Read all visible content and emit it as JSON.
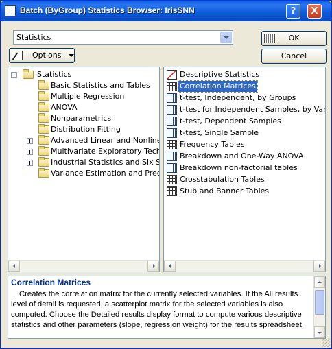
{
  "window": {
    "title": "Batch (ByGroup) Statistics Browser: IrisSNN",
    "help_label": "?",
    "close_label": "X"
  },
  "combo": {
    "value": "Statistics"
  },
  "buttons": {
    "ok": "OK",
    "cancel": "Cancel",
    "options": "Options"
  },
  "tree": {
    "root": "Statistics",
    "items": [
      {
        "label": "Basic Statistics and Tables",
        "expandable": false
      },
      {
        "label": "Multiple Regression",
        "expandable": false
      },
      {
        "label": "ANOVA",
        "expandable": false
      },
      {
        "label": "Nonparametrics",
        "expandable": false
      },
      {
        "label": "Distribution Fitting",
        "expandable": false
      },
      {
        "label": "Advanced Linear and Nonlinear M",
        "expandable": true
      },
      {
        "label": "Multivariate Exploratory Techniqu",
        "expandable": true
      },
      {
        "label": "Industrial Statistics and Six Sigma",
        "expandable": true
      },
      {
        "label": "Variance Estimation and Precision",
        "expandable": false
      }
    ]
  },
  "list": {
    "items": [
      {
        "label": "Descriptive Statistics",
        "icon": "chart-icon",
        "selected": false
      },
      {
        "label": "Correlation Matrices",
        "icon": "matrix-icon",
        "selected": true
      },
      {
        "label": "t-test, Independent, by Groups",
        "icon": "ttest-icon",
        "selected": false
      },
      {
        "label": "t-test for Independent Samples, by Variables",
        "icon": "ttest-icon",
        "selected": false
      },
      {
        "label": "t-test, Dependent Samples",
        "icon": "ttest-icon",
        "selected": false
      },
      {
        "label": "t-test, Single Sample",
        "icon": "ttest-icon",
        "selected": false
      },
      {
        "label": "Frequency Tables",
        "icon": "table-icon",
        "selected": false
      },
      {
        "label": "Breakdown and One-Way ANOVA",
        "icon": "breakdown-icon",
        "selected": false
      },
      {
        "label": "Breakdown non-factorial tables",
        "icon": "breakdown-icon",
        "selected": false
      },
      {
        "label": "Crosstabulation Tables",
        "icon": "table-icon",
        "selected": false
      },
      {
        "label": "Stub and Banner Tables",
        "icon": "table-icon",
        "selected": false
      }
    ]
  },
  "description": {
    "title": "Correlation Matrices",
    "text": "Creates the correlation matrix for the currently selected variables. If the All results level of detail is requested, a scatterplot matrix for the selected variables is also computed. Choose the Detailed results display format to compute various descriptive statistics and other parameters (slope, regression weight) for the results spreadsheet."
  }
}
